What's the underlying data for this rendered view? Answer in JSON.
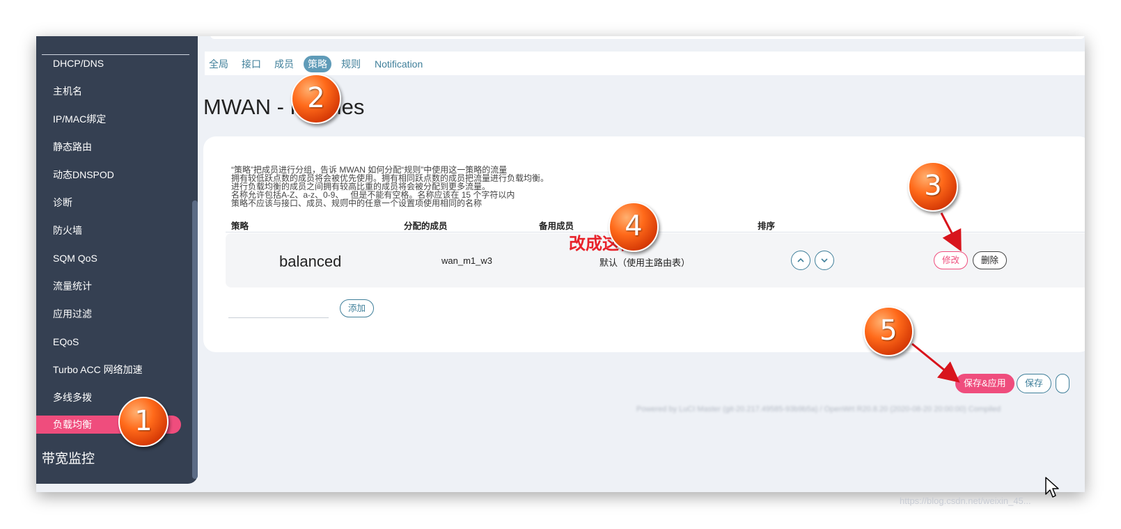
{
  "sidebar": {
    "items": [
      {
        "label": "DHCP/DNS"
      },
      {
        "label": "主机名"
      },
      {
        "label": "IP/MAC绑定"
      },
      {
        "label": "静态路由"
      },
      {
        "label": "动态DNSPOD"
      },
      {
        "label": "诊断"
      },
      {
        "label": "防火墙"
      },
      {
        "label": "SQM QoS"
      },
      {
        "label": "流量统计"
      },
      {
        "label": "应用过滤"
      },
      {
        "label": "EQoS"
      },
      {
        "label": "Turbo ACC 网络加速"
      },
      {
        "label": "多线多拨"
      },
      {
        "label": "负载均衡",
        "active": true
      }
    ],
    "section": "带宽监控"
  },
  "tabs": [
    {
      "label": "全局"
    },
    {
      "label": "接口"
    },
    {
      "label": "成员"
    },
    {
      "label": "策略",
      "active": true
    },
    {
      "label": "规则"
    },
    {
      "label": "Notification"
    }
  ],
  "page": {
    "title": "MWAN - Policies",
    "description": [
      "“策略”把成员进行分组，告诉 MWAN 如何分配“规则”中使用这一策略的流量",
      "拥有较低跃点数的成员将会被优先使用。拥有相同跃点数的成员把流量进行负载均衡。",
      "进行负载均衡的成员之间拥有较高比重的成员将会被分配到更多流量。",
      "名称允许包括A-Z、a-z、0-9、_ 但是不能有空格。名称应该在 15 个字符以内",
      "策略不应该与接口、成员、规则中的任意一个设置项使用相同的名称"
    ]
  },
  "table": {
    "headers": [
      "策略",
      "分配的成员",
      "备用成员",
      "排序"
    ],
    "rows": [
      {
        "policy": "balanced",
        "members": "wan_m1_w3",
        "fallback": "默认（使用主路由表）",
        "edit": "修改",
        "delete": "删除"
      }
    ],
    "add_label": "添加"
  },
  "actions": {
    "save_apply": "保存&应用",
    "save": "保存"
  },
  "footer": "Powered by LuCI Master (git-20.217.49585-93b9b5a) / OpenWrt R20.8.20 (2020-08-20 20:00:00) Compiled",
  "annotation": "改成这样",
  "markers": [
    "1",
    "2",
    "3",
    "4",
    "5"
  ],
  "watermark": "https://blog.csdn.net/weixin_45...",
  "icons": {
    "move_up": "chevron-up-icon",
    "move_down": "chevron-down-icon",
    "cursor": "mouse-pointer-icon"
  },
  "colors": {
    "sidebar_bg": "#354052",
    "accent_pink": "#ef4d7d",
    "accent_teal": "#3f7f9a",
    "marker_orange": "#ff6a1a",
    "annotation_red": "#e8222a"
  }
}
